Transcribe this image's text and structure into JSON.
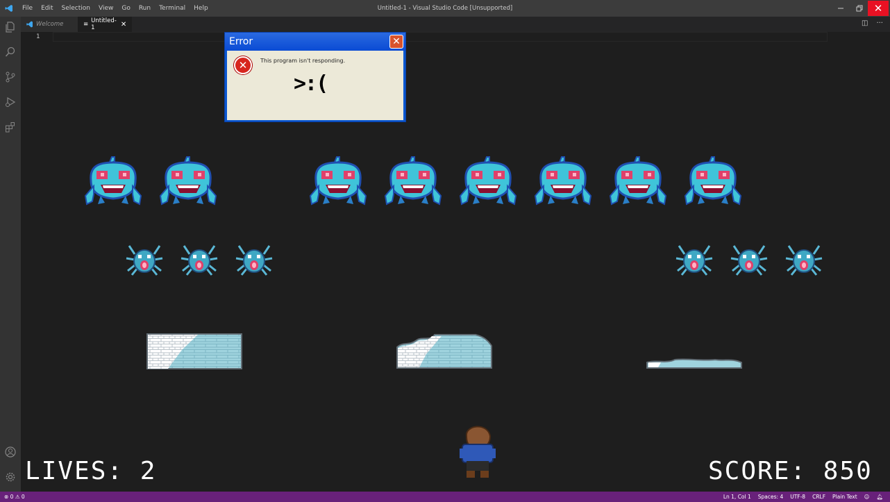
{
  "titlebar": {
    "menu": [
      "File",
      "Edit",
      "Selection",
      "View",
      "Go",
      "Run",
      "Terminal",
      "Help"
    ],
    "title": "Untitled-1 - Visual Studio Code [Unsupported]"
  },
  "tabs": {
    "welcome": "Welcome",
    "untitled": "Untitled-1"
  },
  "editor": {
    "line_number": "1"
  },
  "dialog": {
    "title": "Error",
    "message": "This program isn't responding.",
    "face": ">:("
  },
  "game": {
    "lives_label": "LIVES: 2",
    "score_label": "SCORE: 850",
    "colors": {
      "alien_body": "#3fc4d9",
      "alien_outline": "#1f4fb0",
      "alien_eye": "#e0406a",
      "bunker_ice": "#9fd3de",
      "bunker_white": "#ffffff"
    }
  },
  "status": {
    "problems": "⊗ 0 ⚠ 0",
    "position": "Ln 1, Col 1",
    "spaces": "Spaces: 4",
    "encoding": "UTF-8",
    "eol": "CRLF",
    "language": "Plain Text"
  }
}
